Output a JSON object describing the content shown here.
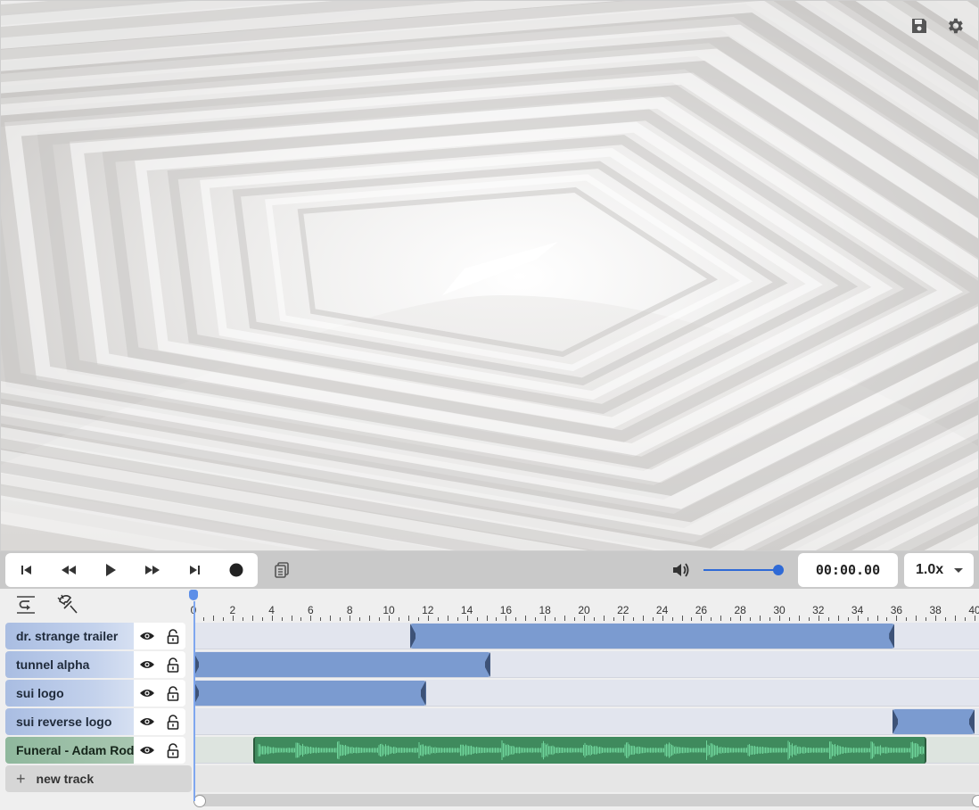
{
  "preview": {
    "save_icon": "save-icon",
    "settings_icon": "gear-icon"
  },
  "transport": {
    "buttons": [
      "skip-to-start-icon",
      "rewind-icon",
      "play-icon",
      "fast-forward-icon",
      "skip-to-end-icon",
      "record-icon"
    ],
    "copy_icon": "copy-icon",
    "volume_icon": "volume-icon",
    "volume_level": 1.0,
    "time": "00:00.00",
    "speed": "1.0x"
  },
  "timeline": {
    "tools": [
      "snap-icon",
      "magnet-icon"
    ],
    "ruler_ticks": [
      "0",
      "2",
      "4",
      "6",
      "8",
      "10",
      "12",
      "14",
      "16",
      "18",
      "20",
      "22",
      "24",
      "26",
      "28",
      "30",
      "32",
      "34",
      "36",
      "38",
      "40"
    ],
    "playhead_time": 0,
    "tracks": [
      {
        "name": "dr. strange trailer",
        "kind": "video",
        "clips": [
          {
            "start": 11.1,
            "end": 35.9
          }
        ]
      },
      {
        "name": "tunnel alpha",
        "kind": "video",
        "clips": [
          {
            "start": 0,
            "end": 15.2
          }
        ]
      },
      {
        "name": "sui logo",
        "kind": "video",
        "clips": [
          {
            "start": 0,
            "end": 11.9
          }
        ]
      },
      {
        "name": "sui reverse logo",
        "kind": "video",
        "clips": [
          {
            "start": 35.8,
            "end": 40
          }
        ]
      },
      {
        "name": "Funeral - Adam Rodgers",
        "kind": "audio",
        "clips": [
          {
            "start": 3.05,
            "end": 37.55
          }
        ]
      }
    ],
    "new_track_label": "new track",
    "colors": {
      "video_clip": "#7b9bd0",
      "audio_clip": "#3f8a5d",
      "waveform": "#6fd49a",
      "accent": "#2f6ad6"
    }
  }
}
